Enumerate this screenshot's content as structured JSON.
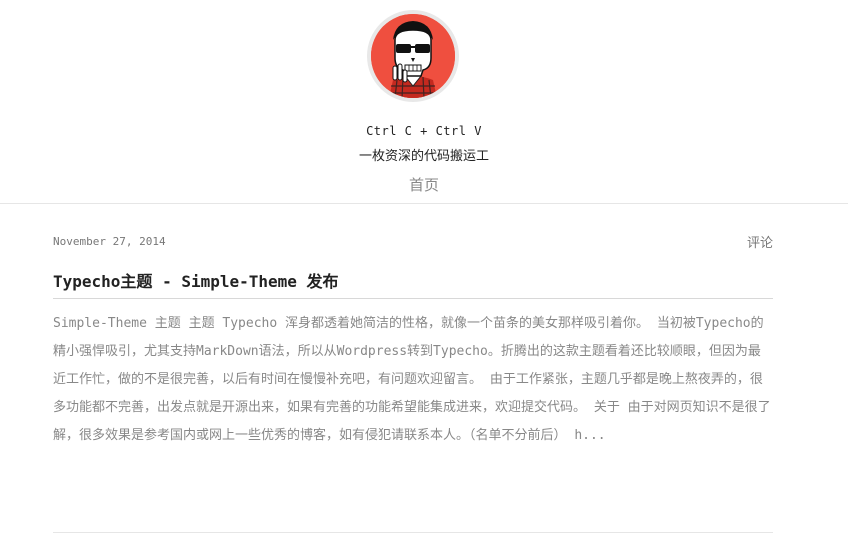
{
  "site": {
    "title": "Ctrl C + Ctrl V",
    "description": "一枚资深的代码搬运工",
    "avatar_icon": "skull-hipster-avatar-icon",
    "avatar_bg": "#ef4f3f"
  },
  "nav": {
    "items": [
      {
        "label": "首页"
      }
    ]
  },
  "post": {
    "date": "November 27, 2014",
    "comments_label": "评论",
    "title": "Typecho主题 - Simple-Theme 发布",
    "excerpt": "Simple-Theme 主题 主题 Typecho 浑身都透着她简洁的性格，就像一个苗条的美女那样吸引着你。 当初被Typecho的精小强悍吸引，尤其支持MarkDown语法，所以从Wordpress转到Typecho。折腾出的这款主题看着还比较顺眼，但因为最近工作忙，做的不是很完善，以后有时间在慢慢补充吧，有问题欢迎留言。 由于工作紧张，主题几乎都是晚上熬夜弄的，很多功能都不完善，出发点就是开源出来，如果有完善的功能希望能集成进来，欢迎提交代码。 关于 由于对网页知识不是很了解，很多效果是参考国内或网上一些优秀的博客，如有侵犯请联系本人。（名单不分前后） h..."
  }
}
